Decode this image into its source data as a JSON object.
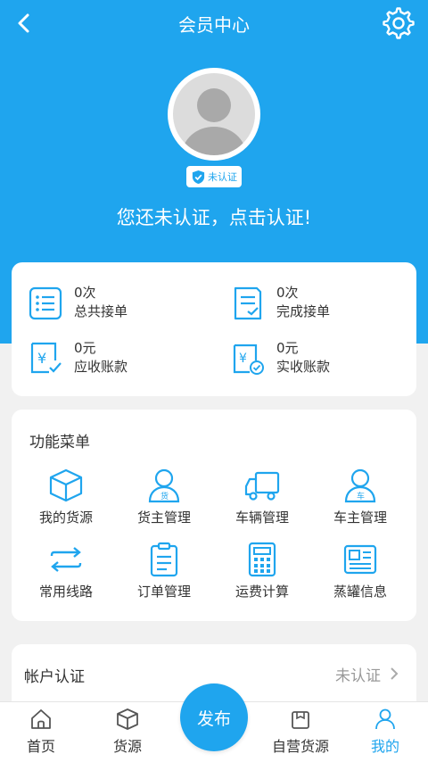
{
  "colors": {
    "accent": "#1fa5ee",
    "background": "#f1f1f1"
  },
  "header": {
    "title": "会员中心",
    "back_icon": "back-arrow-icon",
    "settings_icon": "gear-icon"
  },
  "profile": {
    "badge_label": "未认证",
    "hint": "您还未认证，点击认证!"
  },
  "stats": [
    {
      "value": "0次",
      "label": "总共接单",
      "icon": "list-icon"
    },
    {
      "value": "0次",
      "label": "完成接单",
      "icon": "checklist-icon"
    },
    {
      "value": "0元",
      "label": "应收账款",
      "icon": "receivable-icon"
    },
    {
      "value": "0元",
      "label": "实收账款",
      "icon": "received-icon"
    }
  ],
  "menu": {
    "title": "功能菜单",
    "items": [
      {
        "label": "我的货源",
        "icon": "box-icon"
      },
      {
        "label": "货主管理",
        "icon": "shipper-icon"
      },
      {
        "label": "车辆管理",
        "icon": "truck-icon"
      },
      {
        "label": "车主管理",
        "icon": "car-owner-icon"
      },
      {
        "label": "常用线路",
        "icon": "route-icon"
      },
      {
        "label": "订单管理",
        "icon": "clipboard-icon"
      },
      {
        "label": "运费计算",
        "icon": "calculator-icon"
      },
      {
        "label": "蒸罐信息",
        "icon": "newspaper-icon"
      }
    ]
  },
  "account": {
    "label": "帐户认证",
    "status": "未认证"
  },
  "tabbar": {
    "items": [
      {
        "label": "首页",
        "icon": "home-icon"
      },
      {
        "label": "货源",
        "icon": "cube-icon"
      },
      {
        "label": "自营货源",
        "icon": "package-icon"
      },
      {
        "label": "我的",
        "icon": "user-icon"
      }
    ],
    "publish_label": "发布"
  }
}
